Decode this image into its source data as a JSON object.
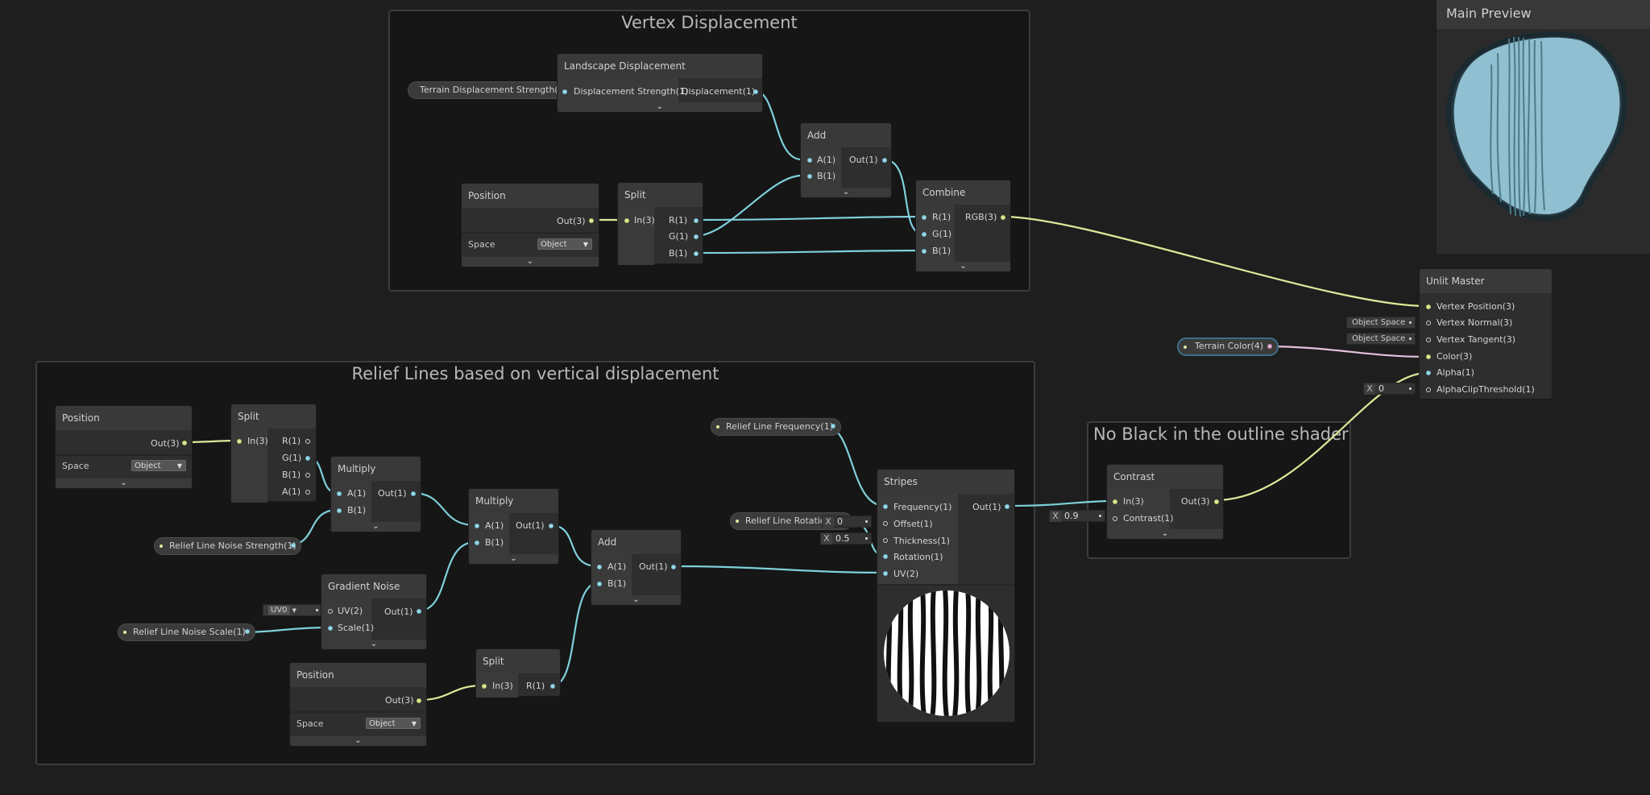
{
  "groups": {
    "vertex": {
      "title": "Vertex Displacement"
    },
    "relief": {
      "title": "Relief Lines based on vertical displacement"
    },
    "noblack": {
      "title": "No Black in the outline shader"
    }
  },
  "nodes": {
    "landscape": {
      "title": "Landscape Displacement",
      "in": "Displacement Strength(1)",
      "out": "Displacement(1)"
    },
    "add_top": {
      "title": "Add",
      "in_a": "A(1)",
      "in_b": "B(1)",
      "out": "Out(1)"
    },
    "position_top": {
      "title": "Position",
      "out": "Out(3)",
      "space_label": "Space",
      "space_value": "Object"
    },
    "split_top": {
      "title": "Split",
      "in": "In(3)",
      "r": "R(1)",
      "g": "G(1)",
      "b": "B(1)"
    },
    "combine": {
      "title": "Combine",
      "r": "R(1)",
      "g": "G(1)",
      "b": "B(1)",
      "out": "RGB(3)"
    },
    "unlit": {
      "title": "Unlit Master",
      "vpos": "Vertex Position(3)",
      "vnorm": "Vertex Normal(3)",
      "vtan": "Vertex Tangent(3)",
      "color": "Color(3)",
      "alpha": "Alpha(1)",
      "clip": "AlphaClipThreshold(1)",
      "space1": "Object Space",
      "space2": "Object Space",
      "clip_x": "X",
      "clip_value": "0"
    },
    "position_l": {
      "title": "Position",
      "out": "Out(3)",
      "space_label": "Space",
      "space_value": "Object"
    },
    "split_l": {
      "title": "Split",
      "in": "In(3)",
      "r": "R(1)",
      "g": "G(1)",
      "b": "B(1)",
      "a": "A(1)"
    },
    "multiply1": {
      "title": "Multiply",
      "in_a": "A(1)",
      "in_b": "B(1)",
      "out": "Out(1)"
    },
    "multiply2": {
      "title": "Multiply",
      "in_a": "A(1)",
      "in_b": "B(1)",
      "out": "Out(1)"
    },
    "gradient": {
      "title": "Gradient Noise",
      "uv": "UV(2)",
      "scale": "Scale(1)",
      "out": "Out(1)",
      "uv_value": "UV0"
    },
    "position_b": {
      "title": "Position",
      "out": "Out(3)",
      "space_label": "Space",
      "space_value": "Object"
    },
    "split_b": {
      "title": "Split",
      "in": "In(3)",
      "r": "R(1)"
    },
    "add_mid": {
      "title": "Add",
      "in_a": "A(1)",
      "in_b": "B(1)",
      "out": "Out(1)"
    },
    "stripes": {
      "title": "Stripes",
      "freq": "Frequency(1)",
      "offset": "Offset(1)",
      "thick": "Thickness(1)",
      "rot": "Rotation(1)",
      "uv": "UV(2)",
      "out": "Out(1)",
      "offset_x": "X",
      "offset_value": "0",
      "thick_x": "X",
      "thick_value": "0.5"
    },
    "contrast": {
      "title": "Contrast",
      "in": "In(3)",
      "contrast": "Contrast(1)",
      "out": "Out(3)",
      "contrast_x": "X",
      "contrast_value": "0.9"
    }
  },
  "properties": {
    "terrain_strength": "Terrain Displacement Strength(1)",
    "terrain_color": "Terrain Color(4)",
    "relief_freq": "Relief Line Frequency(1)",
    "relief_rot": "Relief Line Rotation",
    "relief_noise_strength": "Relief Line Noise Strength(1)",
    "relief_noise_scale": "Relief Line Noise Scale(1)"
  },
  "preview": {
    "title": "Main Preview"
  },
  "colors": {
    "wire_float": "#7fd0db",
    "wire_vec3": "#dfe89a",
    "wire_vec4": "#e4c2dc",
    "preview_blue": "#8fbfd0"
  }
}
